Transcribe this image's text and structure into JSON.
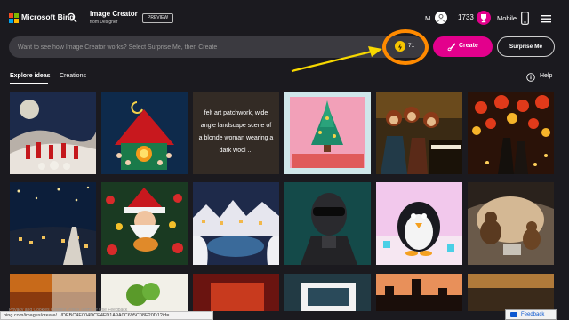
{
  "header": {
    "brand": "Microsoft Bing",
    "title": "Image Creator",
    "subtitle": "from Designer",
    "badge": "PREVIEW",
    "user_initial": "M.",
    "rewards_points": "1733",
    "mobile_label": "Mobile"
  },
  "prompt": {
    "placeholder": "Want to see how Image Creator works? Select Surprise Me, then Create",
    "boosts_remaining": "71",
    "create_label": "Create",
    "surprise_label": "Surprise Me"
  },
  "tabs": [
    {
      "label": "Explore ideas",
      "active": true
    },
    {
      "label": "Creations",
      "active": false
    }
  ],
  "help_label": "Help",
  "gallery": {
    "caption_tile": "felt art patchwork, wide angle landscape scene of a blonde woman wearing a dark wool ..."
  },
  "status_bar_url": "bing.com/images/create/.../DEBC4E004DCE4FD1A9A0C695C08E20D1?id=...",
  "footer": {
    "links": "Privacy and Cookies     Content Policy     Terms of Use     Feedback"
  },
  "feedback_label": "Feedback",
  "colors": {
    "accent": "#e3008c",
    "background": "#1b1a1f",
    "highlight": "#ff8a00"
  }
}
